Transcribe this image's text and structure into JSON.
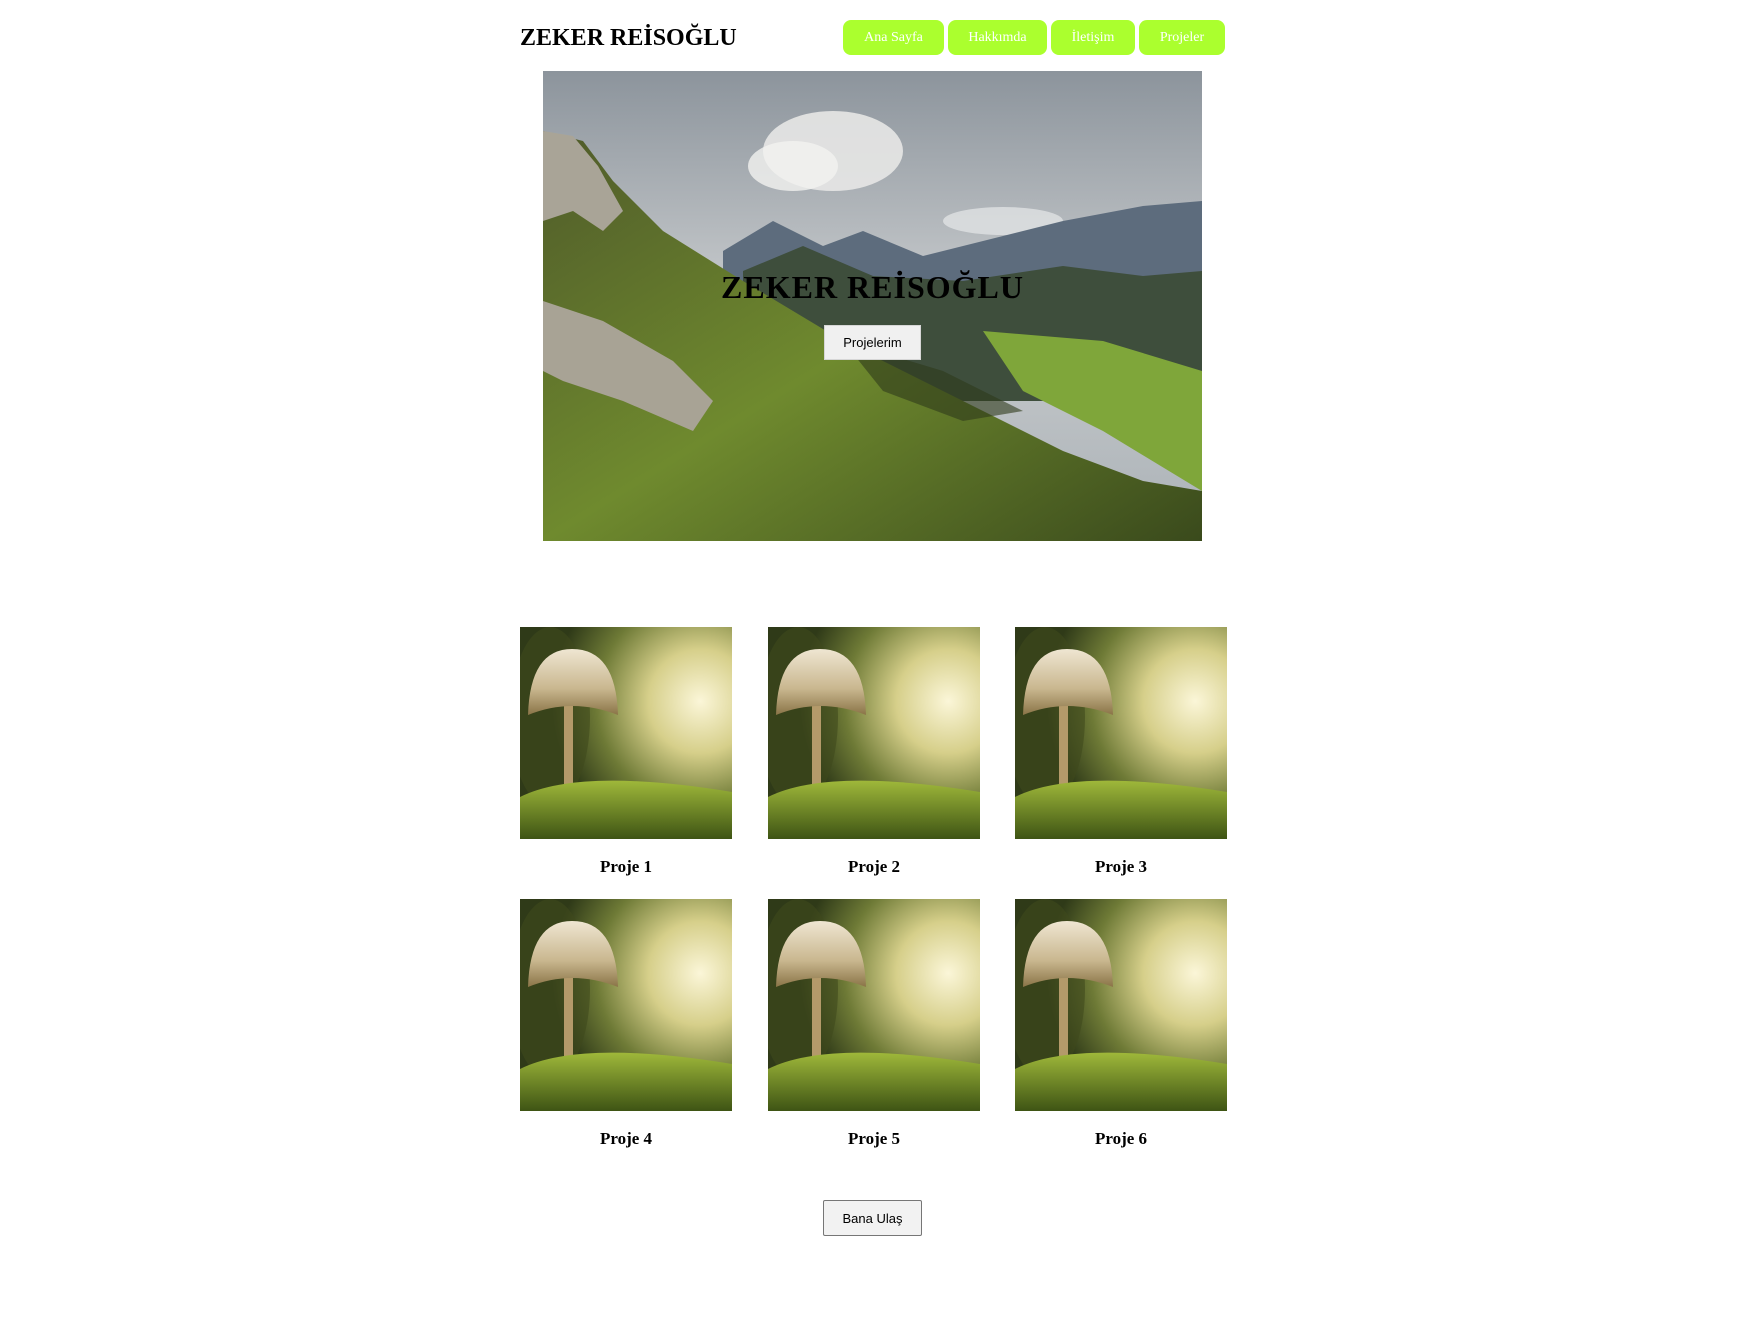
{
  "header": {
    "title": "ZEKER REİSOĞLU",
    "nav": [
      {
        "label": "Ana Sayfa"
      },
      {
        "label": "Hakkımda"
      },
      {
        "label": "İletişim"
      },
      {
        "label": "Projeler"
      }
    ],
    "nav_color": "#abff2e"
  },
  "hero": {
    "image": "mountain-landscape-image",
    "title": "ZEKER REİSOĞLU",
    "button_label": "Projelerim"
  },
  "projects": [
    {
      "title": "Proje 1",
      "image": "mushroom-image"
    },
    {
      "title": "Proje 2",
      "image": "mushroom-image"
    },
    {
      "title": "Proje 3",
      "image": "mushroom-image"
    },
    {
      "title": "Proje 4",
      "image": "mushroom-image"
    },
    {
      "title": "Proje 5",
      "image": "mushroom-image"
    },
    {
      "title": "Proje 6",
      "image": "mushroom-image"
    }
  ],
  "contact": {
    "button_label": "Bana Ulaş"
  }
}
